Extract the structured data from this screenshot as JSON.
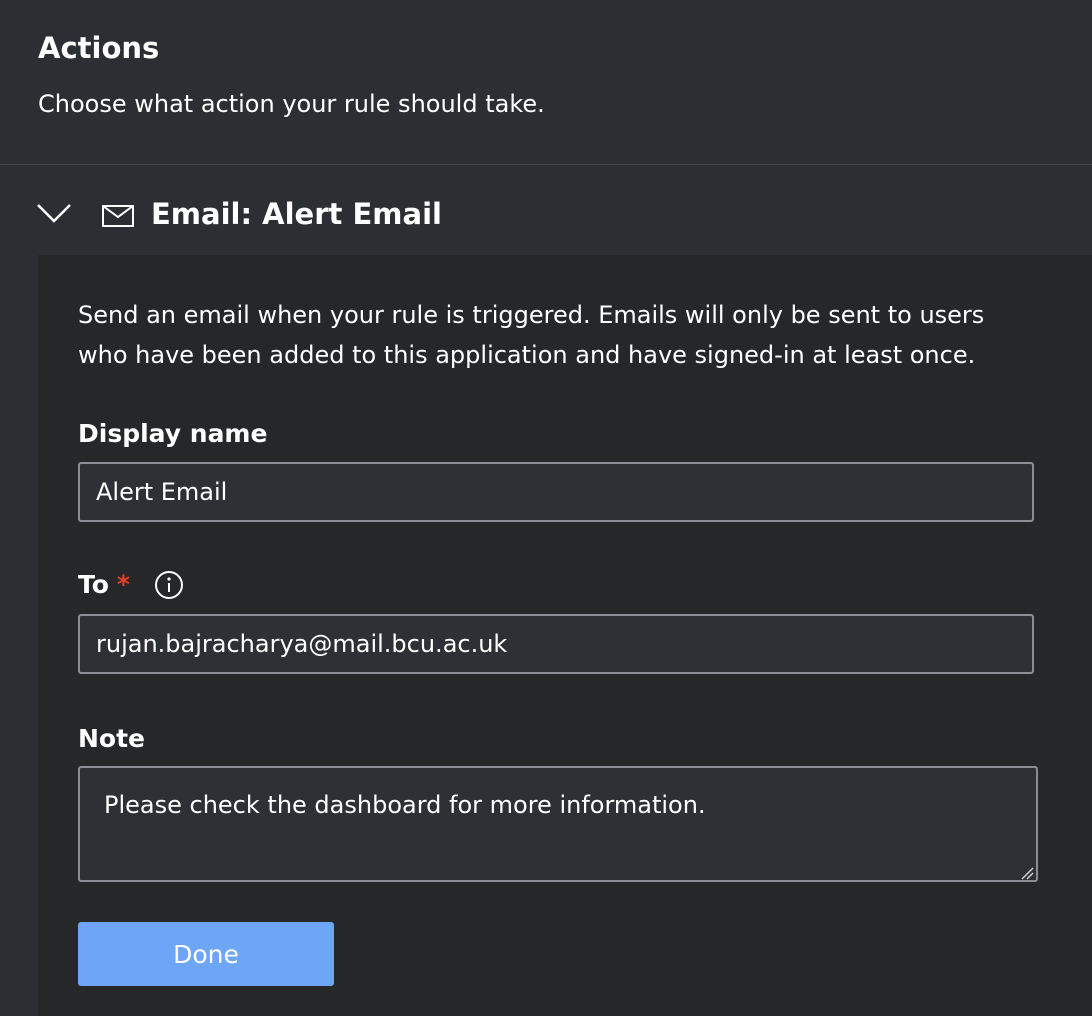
{
  "header": {
    "title": "Actions",
    "subtitle": "Choose what action your rule should take."
  },
  "action": {
    "expand_icon": "chevron-down-icon",
    "type_icon": "mail-icon",
    "title": "Email: Alert Email",
    "description": "Send an email when your rule is triggered. Emails will only be sent to users who have been added to this application and have signed-in at least once.",
    "display_name": {
      "label": "Display name",
      "value": "Alert Email"
    },
    "to": {
      "label": "To",
      "required_marker": "*",
      "info_icon": "info-icon",
      "value": "rujan.bajracharya@mail.bcu.ac.uk"
    },
    "note": {
      "label": "Note",
      "value": "Please check the dashboard for more information."
    },
    "done_label": "Done"
  },
  "colors": {
    "background": "#2b2f33",
    "panel": "#252729",
    "primary_button": "#6ea6f7",
    "required": "#e0402a"
  }
}
